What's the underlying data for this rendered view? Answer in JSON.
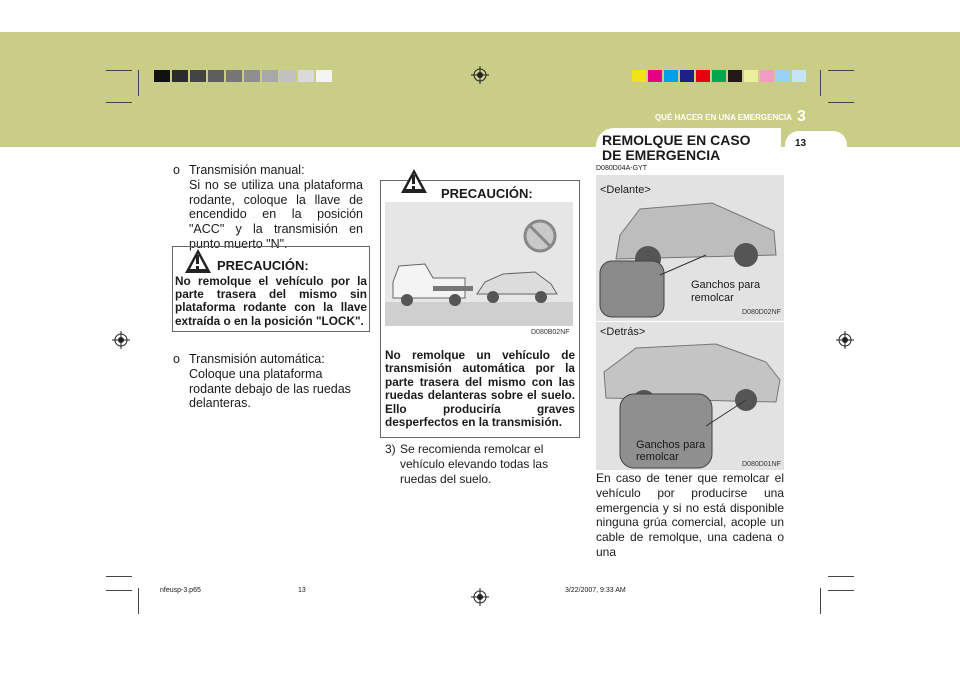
{
  "header": {
    "section_title": "QUÉ HACER EN UNA EMERGENCIA",
    "section_number": "3",
    "page_number": "13",
    "colors": {
      "band": "#c9cd86",
      "accent": "#ffffff"
    }
  },
  "color_bar_left": [
    "#111111",
    "#2b2b2b",
    "#444444",
    "#5d5d5d",
    "#767676",
    "#8f8f8f",
    "#a8a8a8",
    "#c1c1c1",
    "#dadada",
    "#f3f3f3"
  ],
  "color_bar_right": [
    "#f2e21b",
    "#e4007f",
    "#00a0e9",
    "#1d2088",
    "#e60012",
    "#00a650",
    "#231815",
    "#e9ef9c",
    "#f19ec2",
    "#9ad3f1",
    "#c7e4f4"
  ],
  "left_col": {
    "manual_bullet": "o",
    "manual_title": "Transmisión manual:",
    "manual_text": "Si no se utiliza una plataforma rodante, coloque la llave de encendido en la posición \"ACC\" y la transmisión en punto muerto \"N\".",
    "caution_title": "PRECAUCIÓN:",
    "caution_text": "No remolque el vehículo por la parte trasera del mismo sin plataforma rodante con la llave extraída o en la posición \"LOCK\".",
    "auto_bullet": "o",
    "auto_title": "Transmisión automática:",
    "auto_text": "Coloque una plataforma rodante debajo de las ruedas delanteras."
  },
  "middle_col": {
    "caution_title": "PRECAUCIÓN:",
    "image_code": "D080B02NF",
    "caution_text": "No remolque un vehículo de transmisión automática por la parte trasera del mismo con las ruedas delanteras sobre el suelo. Ello produciría graves desperfectos en la transmisión.",
    "item3_number": "3)",
    "item3_text": "Se recomienda remolcar el vehículo elevando todas las ruedas del suelo."
  },
  "right_col": {
    "heading_line1": "REMOLQUE EN CASO",
    "heading_line2": "DE EMERGENCIA",
    "code": "D080D04A-GYT",
    "front_label": "<Delante>",
    "front_hooks": "Ganchos para remolcar",
    "front_image_code": "D080D02NF",
    "rear_label": "<Detrás>",
    "rear_hooks": "Ganchos para remolcar",
    "rear_image_code": "D080D01NF",
    "body_text": "En caso de tener que remolcar el vehículo por producirse una emergencia y si no está disponible ninguna grúa comercial, acople un cable de remolque, una cadena o una"
  },
  "footer": {
    "file": "nfeusp-3.p65",
    "page": "13",
    "datetime": "3/22/2007, 9:33 AM"
  }
}
